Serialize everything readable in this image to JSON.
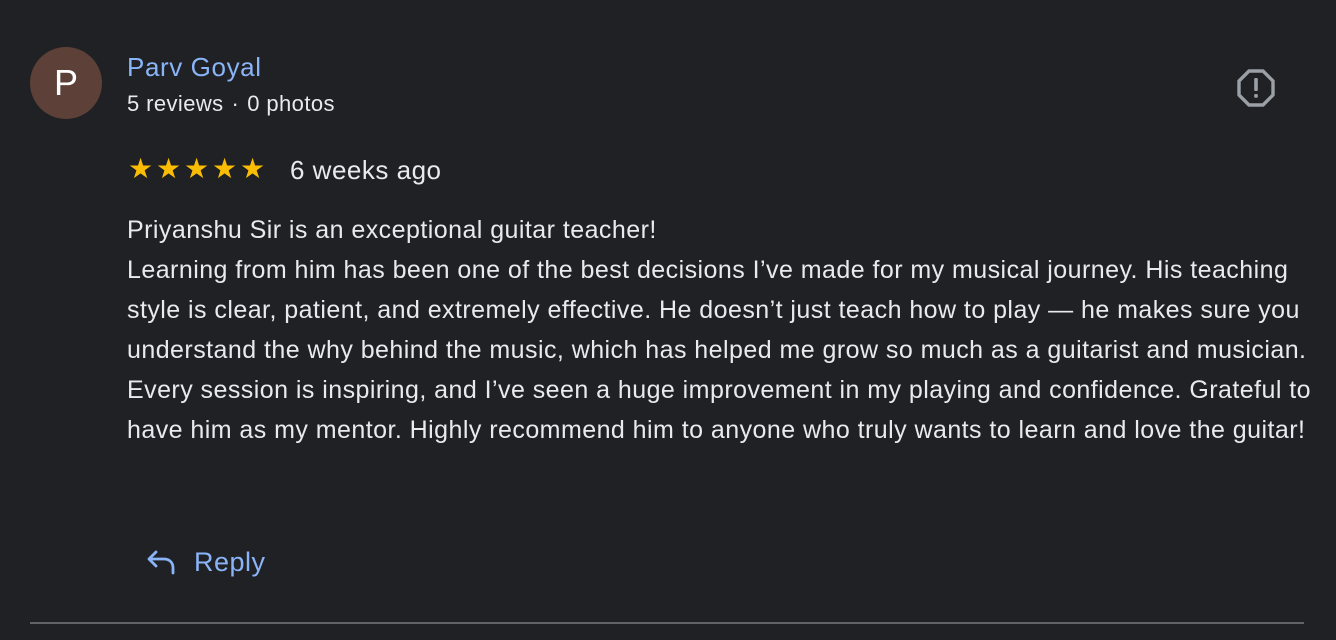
{
  "reviewer": {
    "initial": "P",
    "name": "Parv Goyal",
    "reviews": "5 reviews",
    "separator": "·",
    "photos": "0 photos",
    "avatar_color": "#5d4037"
  },
  "review": {
    "rating": 5,
    "rating_max": 5,
    "star_glyph": "★",
    "time_ago": "6 weeks ago",
    "paragraphs": [
      "Priyanshu Sir is an exceptional guitar teacher!",
      "Learning from him has been one of the best decisions I’ve made for my musical journey. His teaching style is clear, patient, and extremely effective. He doesn’t just teach how to play — he makes sure you understand the why behind the music, which has helped me grow so much as a guitarist and musician. Every session is inspiring, and I’ve seen a huge improvement in my playing and confidence. Grateful to have him as my mentor. Highly recommend him to anyone who truly wants to learn and love the guitar!"
    ]
  },
  "actions": {
    "reply_label": "Reply",
    "reply_icon": "reply-arrow-icon",
    "report_icon": "report-flag-icon"
  },
  "colors": {
    "background": "#202124",
    "link": "#8ab4f8",
    "text": "#e8eaed",
    "star": "#fbbc04",
    "icon": "#9aa0a6",
    "divider": "#5f6368"
  }
}
